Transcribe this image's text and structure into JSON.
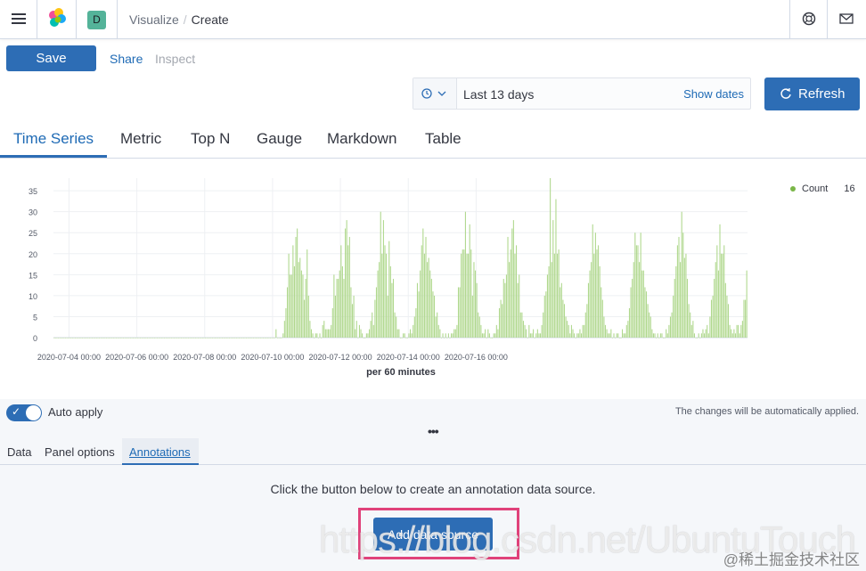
{
  "header": {
    "space_initial": "D",
    "breadcrumb_parent": "Visualize",
    "breadcrumb_separator": "/",
    "breadcrumb_current": "Create"
  },
  "toolbar": {
    "save_label": "Save",
    "share_label": "Share",
    "inspect_label": "Inspect"
  },
  "datepicker": {
    "range": "Last 13 days",
    "show_dates_label": "Show dates",
    "refresh_label": "Refresh"
  },
  "tabs": [
    "Time Series",
    "Metric",
    "Top N",
    "Gauge",
    "Markdown",
    "Table"
  ],
  "active_tab": "Time Series",
  "chart_data": {
    "type": "bar",
    "xlabel": "per 60 minutes",
    "ylim": [
      0,
      38
    ],
    "y_ticks": [
      "0",
      "5",
      "10",
      "15",
      "20",
      "25",
      "30",
      "35"
    ],
    "x_ticks": [
      "2020-07-04 00:00",
      "2020-07-06 00:00",
      "2020-07-08 00:00",
      "2020-07-10 00:00",
      "2020-07-12 00:00",
      "2020-07-14 00:00",
      "2020-07-16 00:00"
    ],
    "x_start": "2020-07-03 13:00",
    "bar_interval_hours": 1,
    "series": [
      {
        "name": "Count",
        "color": "#b0d88e",
        "current_value": "16",
        "values": [
          0,
          0,
          0,
          0,
          0,
          0,
          0,
          0,
          0,
          0,
          0,
          0,
          0,
          0,
          0,
          0,
          0,
          0,
          0,
          0,
          0,
          0,
          0,
          0,
          0,
          0,
          0,
          0,
          0,
          0,
          0,
          0,
          0,
          0,
          0,
          0,
          0,
          0,
          0,
          0,
          0,
          0,
          0,
          0,
          0,
          0,
          0,
          0,
          0,
          0,
          0,
          0,
          0,
          0,
          0,
          0,
          0,
          0,
          0,
          0,
          0,
          0,
          0,
          0,
          0,
          0,
          0,
          0,
          0,
          0,
          0,
          0,
          0,
          0,
          0,
          0,
          0,
          0,
          0,
          0,
          0,
          0,
          0,
          0,
          0,
          0,
          0,
          0,
          0,
          0,
          0,
          0,
          0,
          0,
          0,
          0,
          0,
          0,
          0,
          0,
          0,
          0,
          0,
          0,
          0,
          0,
          0,
          0,
          0,
          0,
          0,
          0,
          0,
          0,
          0,
          0,
          0,
          0,
          0,
          0,
          0,
          0,
          0,
          0,
          0,
          0,
          0,
          0,
          0,
          0,
          0,
          0,
          0,
          0,
          0,
          0,
          0,
          0,
          0,
          0,
          0,
          0,
          0,
          0,
          0,
          0,
          0,
          0,
          0,
          0,
          0,
          0,
          0,
          0,
          0,
          0,
          0,
          2,
          0,
          0,
          0,
          0,
          1,
          4,
          7,
          12,
          20,
          15,
          15,
          22,
          17,
          24,
          26,
          18,
          19,
          16,
          15,
          9,
          14,
          21,
          10,
          4,
          2,
          1,
          0,
          1,
          1,
          0,
          1,
          0,
          3,
          4,
          2,
          2,
          2,
          2,
          3,
          7,
          15,
          10,
          14,
          14,
          16,
          22,
          17,
          14,
          26,
          28,
          22,
          24,
          12,
          8,
          10,
          2,
          4,
          0,
          3,
          2,
          1,
          0,
          0,
          1,
          1,
          2,
          4,
          6,
          3,
          9,
          12,
          16,
          18,
          30,
          20,
          28,
          22,
          20,
          10,
          23,
          17,
          13,
          14,
          6,
          5,
          2,
          2,
          0,
          0,
          1,
          1,
          0,
          0,
          1,
          2,
          1,
          3,
          5,
          7,
          13,
          11,
          16,
          22,
          26,
          20,
          24,
          18,
          19,
          16,
          14,
          11,
          10,
          5,
          6,
          3,
          2,
          0,
          1,
          0,
          1,
          0,
          1,
          0,
          1,
          1,
          2,
          2,
          3,
          12,
          12,
          20,
          21,
          21,
          30,
          20,
          20,
          27,
          21,
          10,
          18,
          16,
          13,
          6,
          5,
          3,
          1,
          1,
          2,
          0,
          2,
          1,
          0,
          0,
          1,
          1,
          3,
          2,
          7,
          9,
          8,
          14,
          13,
          15,
          24,
          18,
          21,
          26,
          28,
          20,
          22,
          13,
          15,
          6,
          6,
          4,
          3,
          2,
          0,
          3,
          1,
          1,
          2,
          0,
          1,
          2,
          1,
          1,
          3,
          6,
          10,
          11,
          15,
          17,
          38,
          18,
          28,
          20,
          33,
          20,
          21,
          12,
          13,
          9,
          8,
          5,
          4,
          3,
          1,
          3,
          2,
          1,
          0,
          1,
          1,
          2,
          1,
          3,
          3,
          6,
          8,
          13,
          16,
          18,
          27,
          20,
          25,
          21,
          22,
          17,
          12,
          9,
          5,
          3,
          2,
          1,
          1,
          2,
          0,
          1,
          0,
          1,
          1,
          0,
          0,
          2,
          1,
          1,
          3,
          4,
          7,
          12,
          14,
          18,
          25,
          22,
          22,
          18,
          25,
          16,
          16,
          12,
          11,
          8,
          6,
          5,
          2,
          1,
          1,
          0,
          1,
          0,
          1,
          1,
          0,
          0,
          2,
          1,
          3,
          5,
          6,
          10,
          14,
          17,
          22,
          24,
          18,
          30,
          25,
          19,
          20,
          14,
          8,
          6,
          3,
          4,
          1,
          0,
          0,
          1,
          0,
          1,
          2,
          1,
          2,
          3,
          1,
          5,
          9,
          10,
          14,
          18,
          22,
          16,
          27,
          20,
          20,
          22,
          13,
          10,
          8,
          3,
          2,
          1,
          2,
          1,
          3,
          3,
          1,
          3,
          4,
          9,
          9,
          16
        ]
      }
    ]
  },
  "legend": {
    "label": "Count",
    "value": "16"
  },
  "bottom": {
    "auto_apply_label": "Auto apply",
    "auto_apply_note": "The changes will be automatically applied.",
    "drag_handle": "•••",
    "subtabs": [
      "Data",
      "Panel options",
      "Annotations"
    ],
    "active_subtab": "Annotations",
    "empty_message": "Click the button below to create an annotation data source.",
    "add_button_label": "Add data source"
  },
  "watermark": {
    "url": "https://blog.csdn.net/UbuntuTouch",
    "site": "@稀土掘金技术社区"
  }
}
